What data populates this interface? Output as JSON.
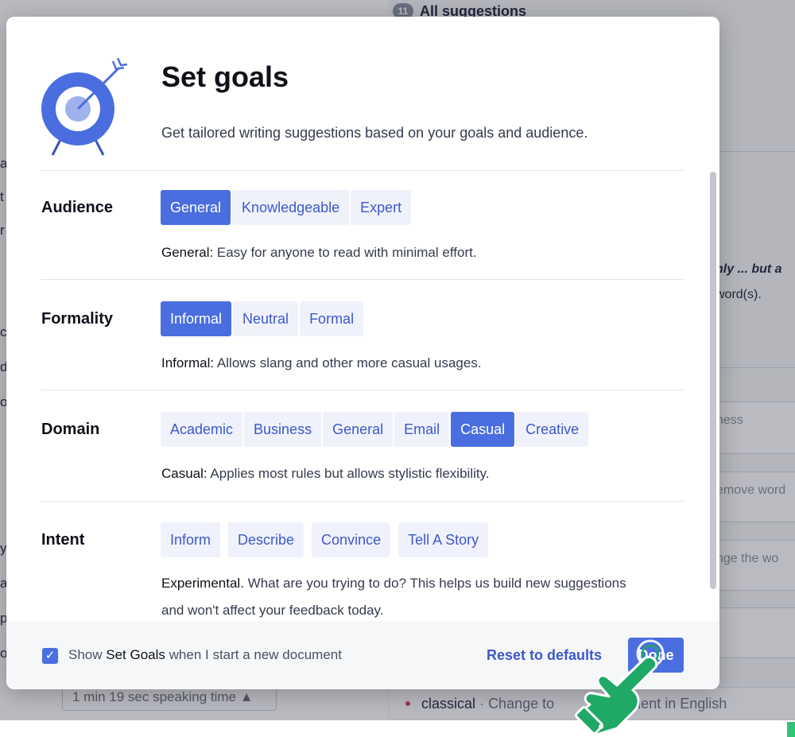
{
  "background": {
    "all_suggestions_count": "11",
    "all_suggestions_label": "All suggestions",
    "left_letters": [
      "a",
      "t",
      "r",
      "c",
      "d",
      "o",
      "y",
      "a",
      "p",
      "o"
    ],
    "speaking_time": "1 min 19 sec speaking time ▲",
    "right_text_1": "nly ... but a",
    "right_text_2": "word(s).",
    "card_1": "ness",
    "card_2": "emove word",
    "card_3": "nge the wo",
    "bottom_row": {
      "word": "classical",
      "separator": "·",
      "text_a": "Change to",
      "text_b": "e fluent in English"
    }
  },
  "modal": {
    "title": "Set goals",
    "subtitle": "Get tailored writing suggestions based on your goals and audience.",
    "audience": {
      "label": "Audience",
      "options": [
        "General",
        "Knowledgeable",
        "Expert"
      ],
      "selected": "General",
      "desc_key": "General:",
      "desc_text": " Easy for anyone to read with minimal effort."
    },
    "formality": {
      "label": "Formality",
      "options": [
        "Informal",
        "Neutral",
        "Formal"
      ],
      "selected": "Informal",
      "desc_key": "Informal:",
      "desc_text": " Allows slang and other more casual usages."
    },
    "domain": {
      "label": "Domain",
      "options": [
        "Academic",
        "Business",
        "General",
        "Email",
        "Casual",
        "Creative"
      ],
      "selected": "Casual",
      "desc_key": "Casual:",
      "desc_text": " Applies most rules but allows stylistic flexibility."
    },
    "intent": {
      "label": "Intent",
      "options": [
        "Inform",
        "Describe",
        "Convince",
        "Tell A Story"
      ],
      "desc_key": "Experimental.",
      "desc_text": " What are you trying to do? This helps us build new suggestions and won't affect your feedback today."
    },
    "footer": {
      "checkbox_checked": true,
      "show_prefix": "Show ",
      "show_bold": "Set Goals",
      "show_suffix": " when I start a new document",
      "reset_label": "Reset to defaults",
      "done_label": "Done"
    }
  },
  "colors": {
    "accent": "#4a6ee0",
    "link": "#3d59c9",
    "option_bg": "#f0f2fb",
    "cursor_green": "#1fa866"
  }
}
